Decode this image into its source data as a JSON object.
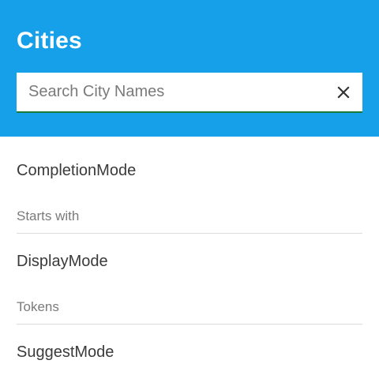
{
  "header": {
    "title": "Cities",
    "background_color": "#17a0ea"
  },
  "search": {
    "placeholder": "Search City Names",
    "value": "",
    "clear_icon": "close-icon"
  },
  "settings": [
    {
      "label": "CompletionMode",
      "value": "Starts with"
    },
    {
      "label": "DisplayMode",
      "value": "Tokens"
    },
    {
      "label": "SuggestMode"
    }
  ]
}
